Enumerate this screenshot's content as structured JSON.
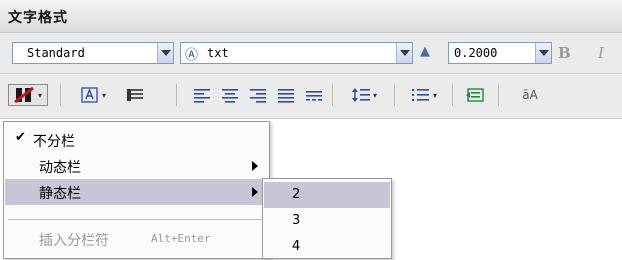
{
  "window": {
    "title": "文字格式"
  },
  "format_toolbar": {
    "style_value": "Standard",
    "font_value": "txt",
    "font_icon": "font-glyph-icon",
    "height_value": "0.2000",
    "bold_label": "B",
    "italic_label": "I"
  },
  "edit_toolbar": {
    "tail_label": "āA",
    "icons": [
      "columns-icon",
      "text-frame-icon",
      "paragraph-icon",
      "align-left-icon",
      "align-center-icon",
      "align-right-icon",
      "justify-icon",
      "distribute-icon",
      "line-spacing-icon",
      "bullet-list-icon",
      "insert-field-icon",
      "uppercase-icon"
    ]
  },
  "columns_menu": {
    "items": [
      {
        "label": "不分栏",
        "checked": true
      },
      {
        "label": "动态栏",
        "submenu": true
      },
      {
        "label": "静态栏",
        "submenu": true,
        "highlighted": true
      },
      {
        "label": "插入分栏符",
        "shortcut": "Alt+Enter",
        "disabled": true
      }
    ]
  },
  "static_columns_submenu": {
    "items": [
      "2",
      "3",
      "4"
    ]
  },
  "colors": {
    "menu_highlight": "#c6c6d6",
    "toolbar_bg": "#ebebeb",
    "icon_blue": "#2a4fa0"
  }
}
